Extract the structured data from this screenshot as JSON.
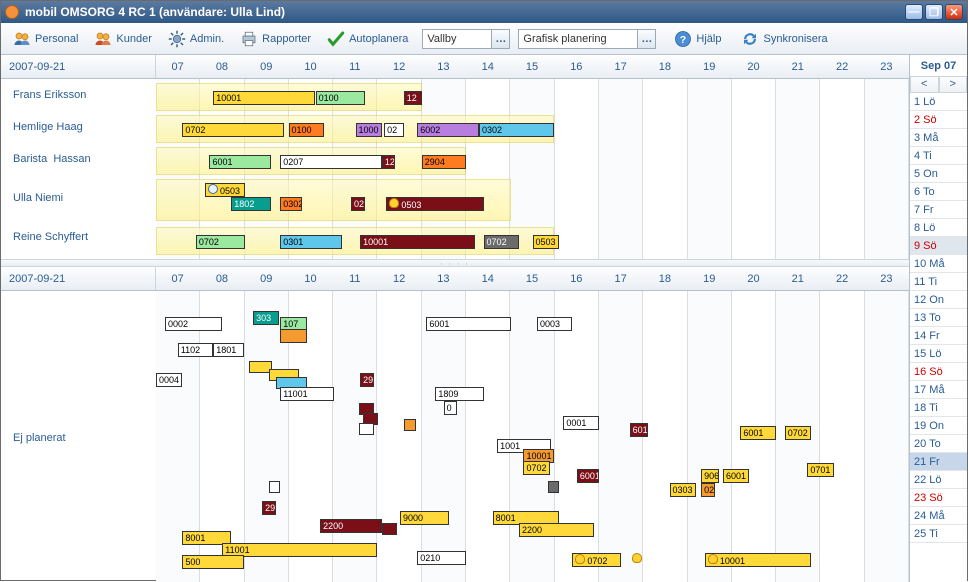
{
  "window_title": "mobil OMSORG 4 RC 1 (användare: Ulla Lind)",
  "toolbar": {
    "personal": "Personal",
    "kunder": "Kunder",
    "admin": "Admin.",
    "rapporter": "Rapporter",
    "autoplanera": "Autoplanera",
    "area_value": "Vallby",
    "view_value": "Grafisk planering",
    "help": "Hjälp",
    "sync": "Synkronisera"
  },
  "calendar": {
    "month": "Sep 07",
    "prev": "<",
    "next": ">",
    "days": [
      {
        "lbl": "1 Lö"
      },
      {
        "lbl": "2 Sö",
        "red": true
      },
      {
        "lbl": "3 Må"
      },
      {
        "lbl": "4 Ti"
      },
      {
        "lbl": "5 On"
      },
      {
        "lbl": "6 To"
      },
      {
        "lbl": "7 Fr"
      },
      {
        "lbl": "8 Lö"
      },
      {
        "lbl": "9 Sö",
        "red": true,
        "sel2": true
      },
      {
        "lbl": "10 Må"
      },
      {
        "lbl": "11 Ti"
      },
      {
        "lbl": "12 On"
      },
      {
        "lbl": "13 To"
      },
      {
        "lbl": "14 Fr"
      },
      {
        "lbl": "15 Lö"
      },
      {
        "lbl": "16 Sö",
        "red": true
      },
      {
        "lbl": "17 Må"
      },
      {
        "lbl": "18 Ti"
      },
      {
        "lbl": "19 On"
      },
      {
        "lbl": "20 To"
      },
      {
        "lbl": "21 Fr",
        "sel": true
      },
      {
        "lbl": "22 Lö"
      },
      {
        "lbl": "23 Sö",
        "red": true
      },
      {
        "lbl": "24 Må"
      },
      {
        "lbl": "25 Ti"
      }
    ]
  },
  "hours": [
    "07",
    "08",
    "09",
    "10",
    "11",
    "12",
    "13",
    "14",
    "15",
    "16",
    "17",
    "18",
    "19",
    "20",
    "21",
    "22",
    "23"
  ],
  "top_date": "2007-09-21",
  "bottom_date": "2007-09-21",
  "bottom_label": "Ej planerat",
  "rows": [
    "Frans Eriksson",
    "Hemlige Haag",
    "Barista  Hassan",
    "Ulla Niemi",
    "Reine Schyffert"
  ],
  "chart_data": {
    "type": "gantt",
    "x_unit": "hour",
    "x_range": [
      7,
      24
    ],
    "date": "2007-09-21",
    "top_pane": {
      "rows": [
        {
          "name": "Frans Eriksson",
          "avail": {
            "start": 7,
            "end": 13
          },
          "tasks": [
            {
              "id": "10001",
              "start": 8.3,
              "end": 10.6,
              "color": "yellow"
            },
            {
              "id": "0100",
              "start": 10.6,
              "end": 11.7,
              "color": "green"
            },
            {
              "id": "12",
              "start": 12.6,
              "end": 13.0,
              "color": "darkred"
            }
          ]
        },
        {
          "name": "Hemlige Haag",
          "avail": {
            "start": 7,
            "end": 16
          },
          "tasks": [
            {
              "id": "0702",
              "start": 7.6,
              "end": 9.9,
              "color": "yellow"
            },
            {
              "id": "0100",
              "start": 10.0,
              "end": 10.8,
              "color": "orange"
            },
            {
              "id": "1000",
              "start": 11.5,
              "end": 12.1,
              "color": "purple"
            },
            {
              "id": "02",
              "start": 12.15,
              "end": 12.6,
              "color": "white"
            },
            {
              "id": "6002",
              "start": 12.9,
              "end": 14.3,
              "color": "purple"
            },
            {
              "id": "0302",
              "start": 14.3,
              "end": 16.0,
              "color": "cyan"
            }
          ]
        },
        {
          "name": "Barista Hassan",
          "avail": {
            "start": 7,
            "end": 14
          },
          "tasks": [
            {
              "id": "6001",
              "start": 8.2,
              "end": 9.6,
              "color": "green"
            },
            {
              "id": "0207",
              "start": 9.8,
              "end": 12.1,
              "color": "white"
            },
            {
              "id": "12",
              "start": 12.1,
              "end": 12.4,
              "color": "darkred"
            },
            {
              "id": "2904",
              "start": 13.0,
              "end": 14.0,
              "color": "orange"
            }
          ]
        },
        {
          "name": "Ulla Niemi",
          "avail": {
            "start": 7,
            "end": 15
          },
          "tasks": [
            {
              "id": "0503",
              "start": 8.1,
              "end": 9.0,
              "color": "yellow",
              "row": 0,
              "icon": "clock"
            },
            {
              "id": "1802",
              "start": 8.7,
              "end": 9.6,
              "color": "teal",
              "row": 1
            },
            {
              "id": "0302",
              "start": 9.8,
              "end": 10.3,
              "color": "orange",
              "row": 1
            },
            {
              "id": "02",
              "start": 11.4,
              "end": 11.7,
              "color": "darkred",
              "row": 1
            },
            {
              "id": "0503",
              "start": 12.2,
              "end": 14.4,
              "color": "darkred",
              "row": 1,
              "icon": "bulb"
            }
          ]
        },
        {
          "name": "Reine Schyffert",
          "avail": {
            "start": 7,
            "end": 16
          },
          "tasks": [
            {
              "id": "0702",
              "start": 7.9,
              "end": 9.0,
              "color": "green"
            },
            {
              "id": "0301",
              "start": 9.8,
              "end": 11.2,
              "color": "cyan"
            },
            {
              "id": "10001",
              "start": 11.6,
              "end": 14.2,
              "color": "darkred"
            },
            {
              "id": "0702",
              "start": 14.4,
              "end": 15.2,
              "color": "gray"
            },
            {
              "id": "0503",
              "start": 15.5,
              "end": 16.1,
              "color": "yellow"
            }
          ]
        }
      ]
    },
    "bottom_pane": {
      "label": "Ej planerat",
      "tasks": [
        {
          "id": "0002",
          "start": 7.2,
          "end": 8.5,
          "color": "white"
        },
        {
          "id": "303",
          "start": 9.2,
          "end": 9.8,
          "color": "teal"
        },
        {
          "id": "107",
          "start": 9.8,
          "end": 10.4,
          "color": "green"
        },
        {
          "id": "1801",
          "start": 7.5,
          "end": 8.3,
          "color": "white"
        },
        {
          "id": "0004",
          "start": 7.0,
          "end": 7.6,
          "color": "white"
        },
        {
          "id": "11001",
          "start": 9.8,
          "end": 11.0,
          "color": "white"
        },
        {
          "id": "29",
          "start": 11.5,
          "end": 11.8,
          "color": "darkred"
        },
        {
          "id": "6001",
          "start": 13.1,
          "end": 15.0,
          "color": "white"
        },
        {
          "id": "0003",
          "start": 15.6,
          "end": 16.4,
          "color": "white"
        },
        {
          "id": "1809",
          "start": 13.3,
          "end": 14.4,
          "color": "white"
        },
        {
          "id": "0",
          "start": 13.5,
          "end": 13.8,
          "color": "white"
        },
        {
          "id": "1001",
          "start": 14.7,
          "end": 15.9,
          "color": "white"
        },
        {
          "id": "0001",
          "start": 16.2,
          "end": 17.0,
          "color": "white"
        },
        {
          "id": "601",
          "start": 17.7,
          "end": 18.1,
          "color": "darkred"
        },
        {
          "id": "6001",
          "start": 20.2,
          "end": 21.0,
          "color": "yellow"
        },
        {
          "id": "0702",
          "start": 21.2,
          "end": 21.8,
          "color": "yellow"
        },
        {
          "id": "10001",
          "start": 15.3,
          "end": 16.0,
          "color": "orange"
        },
        {
          "id": "0702",
          "start": 15.3,
          "end": 15.9,
          "color": "yellow"
        },
        {
          "id": "6001",
          "start": 16.5,
          "end": 17.0,
          "color": "darkred"
        },
        {
          "id": "906",
          "start": 19.3,
          "end": 19.7,
          "color": "yellow"
        },
        {
          "id": "6001",
          "start": 19.8,
          "end": 20.4,
          "color": "yellow"
        },
        {
          "id": "0701",
          "start": 21.7,
          "end": 22.3,
          "color": "yellow"
        },
        {
          "id": "0303",
          "start": 18.6,
          "end": 19.2,
          "color": "yellow"
        },
        {
          "id": "02",
          "start": 19.3,
          "end": 19.6,
          "color": "orange"
        },
        {
          "id": "29",
          "start": 9.4,
          "end": 9.7,
          "color": "darkred"
        },
        {
          "id": "9000",
          "start": 12.5,
          "end": 13.6,
          "color": "yellow"
        },
        {
          "id": "2200",
          "start": 10.7,
          "end": 12.1,
          "color": "darkred"
        },
        {
          "id": "8001",
          "start": 14.6,
          "end": 16.1,
          "color": "yellow"
        },
        {
          "id": "2200",
          "start": 15.2,
          "end": 16.9,
          "color": "yellow"
        },
        {
          "id": "8001",
          "start": 7.6,
          "end": 8.7,
          "color": "yellow"
        },
        {
          "id": "11001",
          "start": 8.5,
          "end": 12.0,
          "color": "yellow"
        },
        {
          "id": "500",
          "start": 7.6,
          "end": 9.0,
          "color": "yellow"
        },
        {
          "id": "0210",
          "start": 12.9,
          "end": 14.0,
          "color": "white"
        },
        {
          "id": "0702",
          "start": 16.4,
          "end": 17.5,
          "color": "yellow",
          "icon": "bulb"
        },
        {
          "id": "10001",
          "start": 19.4,
          "end": 21.8,
          "color": "yellow",
          "icon": "bulb"
        }
      ]
    }
  }
}
